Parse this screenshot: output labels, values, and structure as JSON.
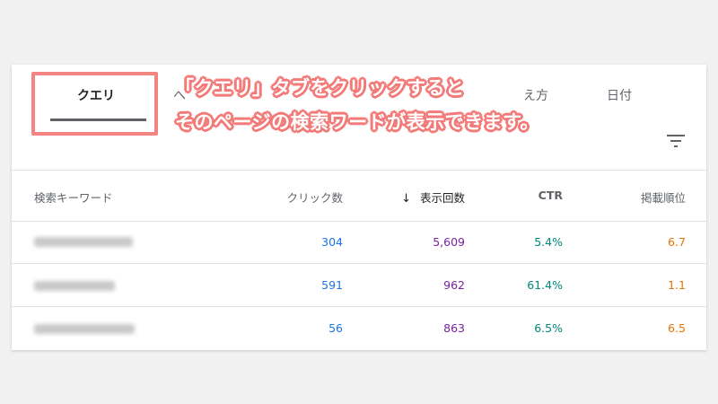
{
  "tabs": {
    "query": "クエリ",
    "pages": "へ",
    "countries": "え方",
    "dates": "日付"
  },
  "table": {
    "headers": {
      "keyword": "検索キーワード",
      "clicks": "クリック数",
      "impressions": "表示回数",
      "ctr": "CTR",
      "position": "掲載順位"
    },
    "rows": [
      {
        "clicks": "304",
        "impressions": "5,609",
        "ctr": "5.4%",
        "position": "6.7"
      },
      {
        "clicks": "591",
        "impressions": "962",
        "ctr": "61.4%",
        "position": "1.1"
      },
      {
        "clicks": "56",
        "impressions": "863",
        "ctr": "6.5%",
        "position": "6.5"
      }
    ]
  },
  "annotation": {
    "line1": "「クエリ」タブをクリックすると",
    "line2": "そのページの検索ワードが表示できます。"
  },
  "colors": {
    "clicks": "#1a73e8",
    "impressions": "#7b1fa2",
    "ctr": "#00897b",
    "position": "#e37400",
    "highlight": "#f28482"
  },
  "icons": {
    "filter": "filter-icon",
    "sort": "arrow-down-icon"
  }
}
